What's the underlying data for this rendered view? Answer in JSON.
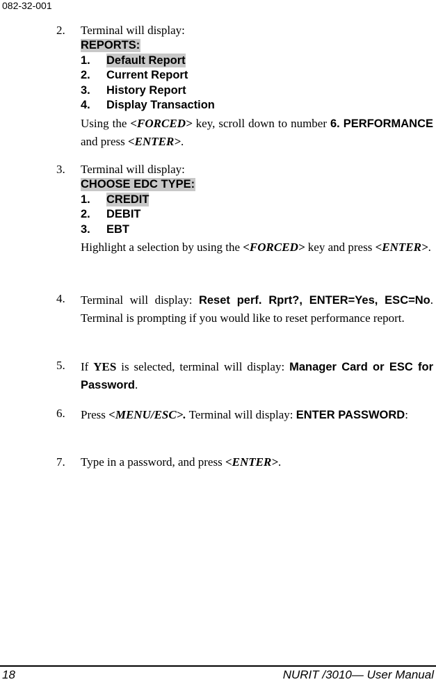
{
  "header": {
    "doc_id": "082-32-001"
  },
  "steps": [
    {
      "num": "2.",
      "intro": "Terminal will display:",
      "screen_header": "REPORTS:",
      "options": [
        {
          "num": "1.",
          "label": "Default Report",
          "highlighted": true
        },
        {
          "num": "2.",
          "label": "Current Report",
          "highlighted": false
        },
        {
          "num": "3.",
          "label": "History Report",
          "highlighted": false
        },
        {
          "num": "4.",
          "label": "Display Transaction",
          "highlighted": false
        }
      ],
      "instruction": {
        "t1": "Using the ",
        "key1": "<FORCED>",
        "t2": " key, scroll down to number ",
        "bold1": "6.",
        "bold2": "PERFORMANCE",
        "t3": " and press ",
        "key2": "<ENTER>",
        "t4": "."
      }
    },
    {
      "num": "3.",
      "intro": "Terminal will display:",
      "screen_header": "CHOOSE EDC TYPE:",
      "options": [
        {
          "num": "1.",
          "label": "CREDIT",
          "highlighted": true
        },
        {
          "num": "2.",
          "label": "DEBIT",
          "highlighted": false
        },
        {
          "num": "3.",
          "label": "EBT",
          "highlighted": false
        }
      ],
      "instruction": {
        "t1": "Highlight a selection by using the ",
        "key1": "<FORCED>",
        "t2": " key and press ",
        "key2": "<ENTER>",
        "t3": "."
      }
    },
    {
      "num": "4.",
      "t1": "Terminal will display: ",
      "disp1": "Reset perf. Rprt?, ENTER=Yes, ESC=No",
      "t2": ".  Terminal is prompting if you would like to reset performance report."
    },
    {
      "num": "5.",
      "t1": "If ",
      "yes": "YES",
      "t2": " is selected, terminal will display: ",
      "disp1": "Manager Card or ESC for Password",
      "t3": "."
    },
    {
      "num": "6.",
      "t1": "Press ",
      "key1": "<MENU/ESC>.",
      "t2": "  Terminal will display: ",
      "disp1": "ENTER PASSWORD",
      "t3": ":"
    },
    {
      "num": "7.",
      "t1": "Type in a password, and press ",
      "key1": "<ENTER>",
      "t2": "."
    }
  ],
  "footer": {
    "page_number": "18",
    "manual_title": "NURIT /3010— User Manual"
  },
  "colors": {
    "highlight": "#c8c8c8",
    "text": "#000000"
  }
}
